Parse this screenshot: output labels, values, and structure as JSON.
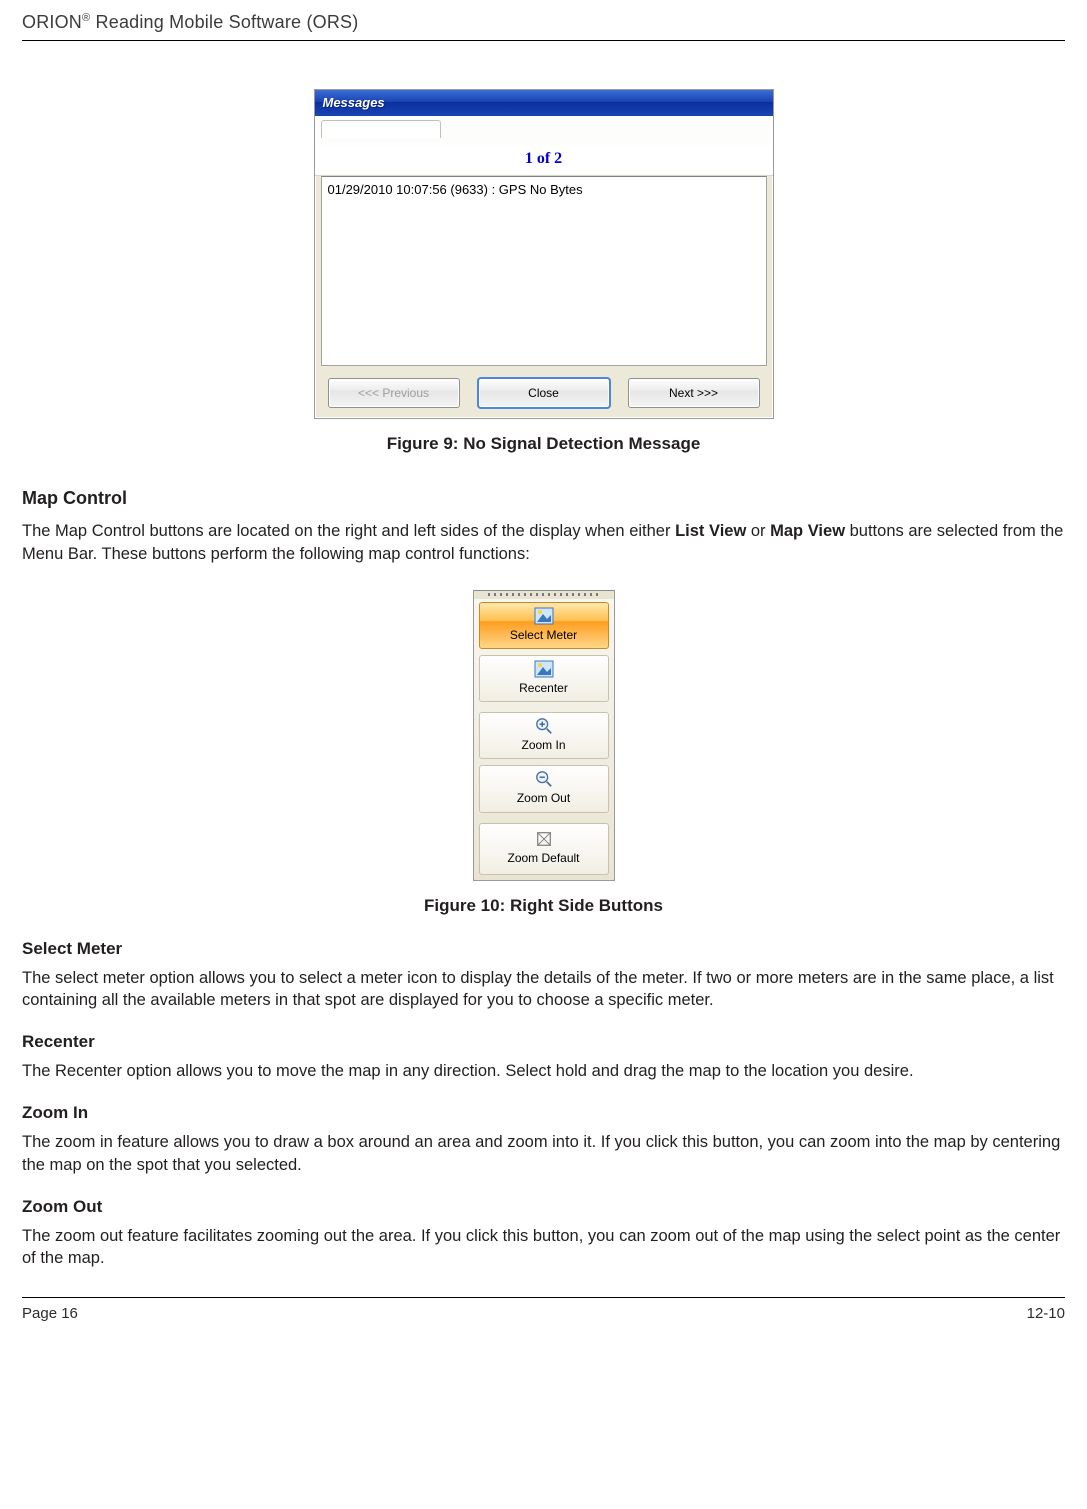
{
  "running_head": {
    "pre": "ORION",
    "sup": "®",
    "post": " Reading Mobile Software (ORS)"
  },
  "fig9": {
    "title": "Messages",
    "counter": "1 of 2",
    "message_line": "01/29/2010 10:07:56 (9633) : GPS No Bytes",
    "btn_prev": "<<< Previous",
    "btn_close": "Close",
    "btn_next": "Next >>>",
    "caption": "Figure 9: No Signal Detection Message"
  },
  "map_control": {
    "heading": "Map Control",
    "para_pre": "The Map Control buttons are located on the right and left sides of the display when either ",
    "bold1": "List View",
    "mid": " or ",
    "bold2": "Map View",
    "para_post": " buttons are selected from the Menu Bar.  These buttons perform the following map control functions:"
  },
  "fig10": {
    "items": [
      {
        "label": "Select Meter",
        "icon": "image-icon",
        "selected": true
      },
      {
        "label": "Recenter",
        "icon": "image-icon",
        "selected": false
      },
      {
        "label": "Zoom In",
        "icon": "zoom-in-icon",
        "selected": false
      },
      {
        "label": "Zoom Out",
        "icon": "zoom-out-icon",
        "selected": false
      },
      {
        "label": "Zoom Default",
        "icon": "reset-icon",
        "selected": false
      }
    ],
    "caption": "Figure 10: Right Side Buttons"
  },
  "select_meter": {
    "heading": "Select Meter",
    "body": "The select meter option allows you to select a meter icon to display the details of the meter. If two or more meters are in the same place, a list containing all the available meters in that spot are displayed for you to choose a specific meter."
  },
  "recenter": {
    "heading": "Recenter",
    "body": "The Recenter option allows you to move the map in any direction. Select hold and drag the map to the location you desire."
  },
  "zoom_in": {
    "heading": "Zoom In",
    "body": "The zoom in feature allows you to draw a box around an area and zoom into it. If you click this button, you can zoom into the map by centering the map on the spot that you selected."
  },
  "zoom_out": {
    "heading": "Zoom Out",
    "body": "The zoom out feature facilitates zooming out the area. If you click this button, you can zoom out of the map using the select point as the center of the map."
  },
  "footer": {
    "left": "Page 16",
    "right": "12-10"
  }
}
